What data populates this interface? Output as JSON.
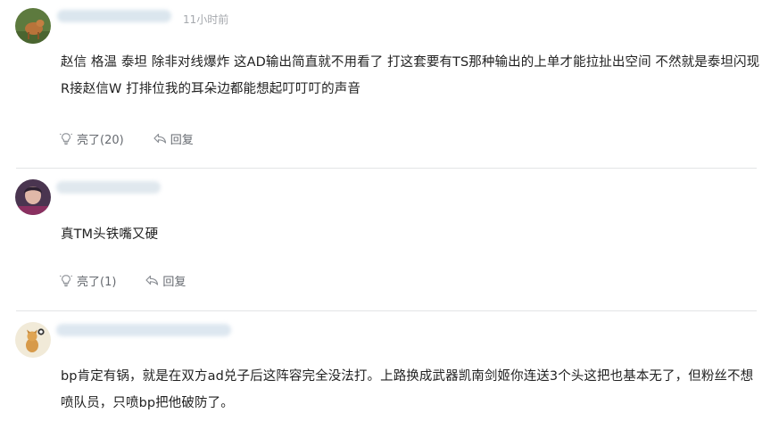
{
  "comments": [
    {
      "timestamp": "11小时前",
      "text": "赵信 格温 泰坦 除非对线爆炸 这AD输出简直就不用看了 打这套要有TS那种输出的上单才能拉扯出空间 不然就是泰坦闪现R接赵信W 打排位我的耳朵边都能想起叮叮叮的声音",
      "like_label": "亮了(20)",
      "reply_label": "回复"
    },
    {
      "timestamp": "",
      "text": "真TM头铁嘴又硬",
      "like_label": "亮了(1)",
      "reply_label": "回复"
    },
    {
      "timestamp": "",
      "text": "bp肯定有锅，就是在双方ad兑子后这阵容完全没法打。上路换成武器凯南剑姬你连送3个头这把也基本无了，但粉丝不想喷队员，只喷bp把他破防了。",
      "like_label": "",
      "reply_label": ""
    }
  ],
  "icons": {
    "like": "lightbulb-icon",
    "reply": "reply-arrow-icon"
  },
  "colors": {
    "text": "#222222",
    "meta": "#a5a8ad",
    "action": "#666a70",
    "divider": "#e3e4e6"
  }
}
